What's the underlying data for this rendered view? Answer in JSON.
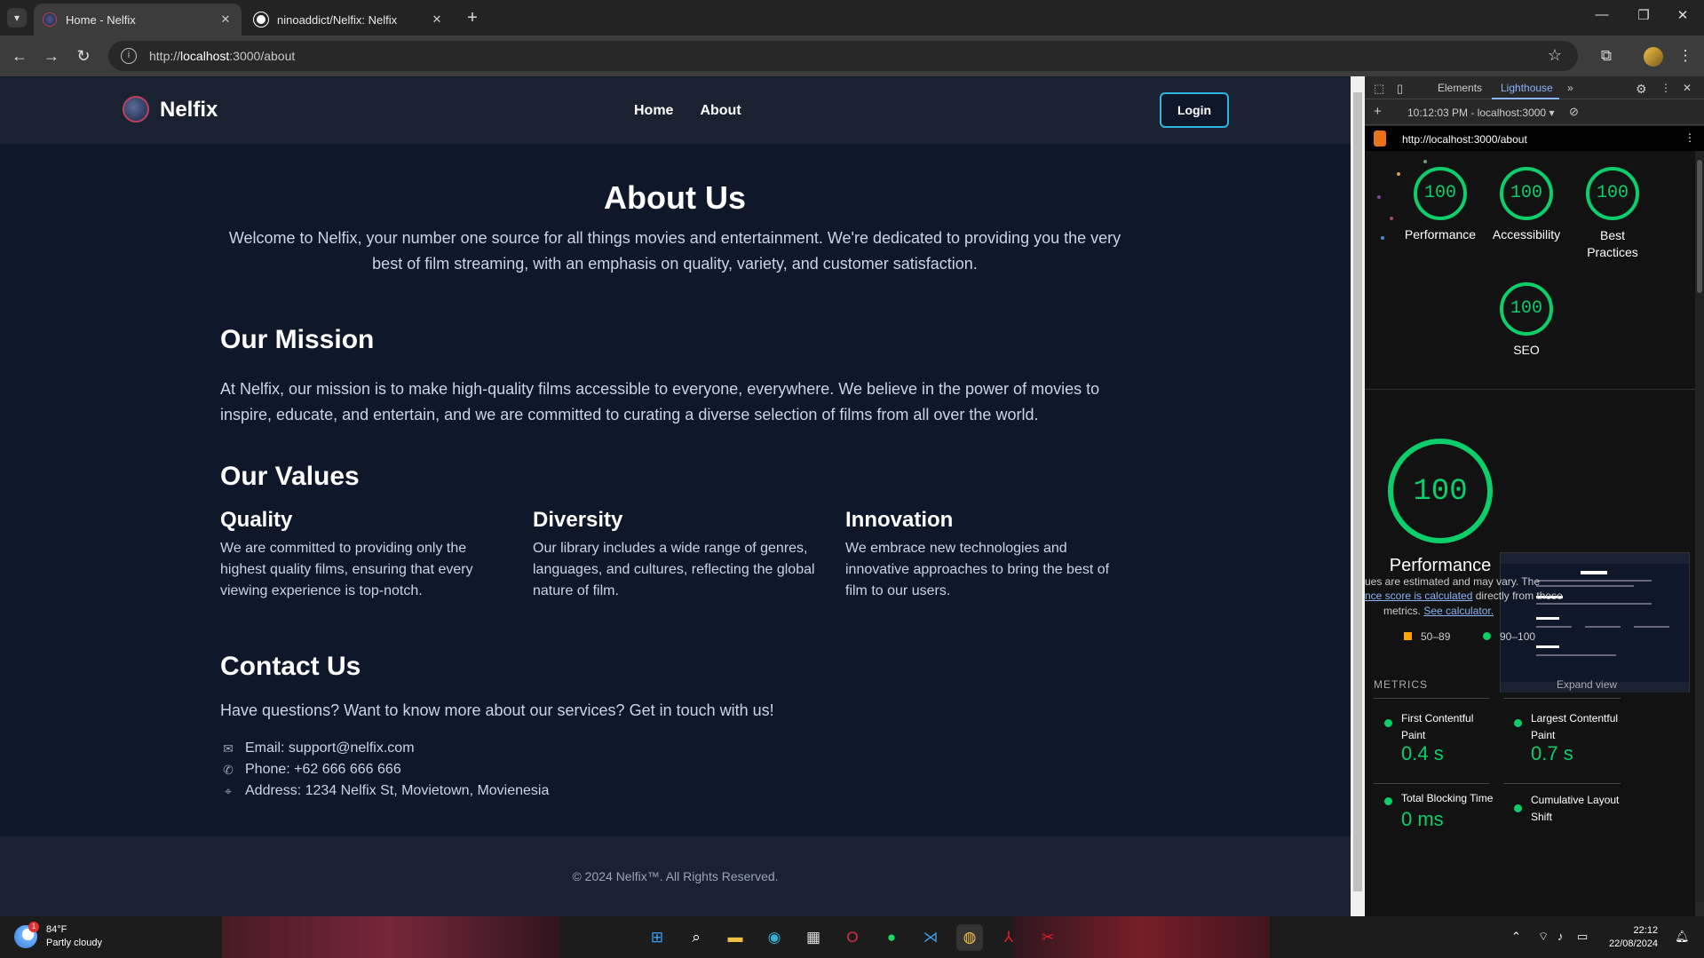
{
  "browser": {
    "tabs": [
      {
        "title": "Home - Nelfix",
        "active": true
      },
      {
        "title": "ninoaddict/Nelfix: Nelfix",
        "active": false
      }
    ],
    "url_prefix": "http://",
    "url_host": "localhost",
    "url_rest": ":3000/about"
  },
  "site": {
    "brand": "Nelfix",
    "nav": {
      "home": "Home",
      "about": "About"
    },
    "login": "Login",
    "about_title": "About Us",
    "intro": "Welcome to Nelfix, your number one source for all things movies and entertainment. We're dedicated to providing you the very best of film streaming, with an emphasis on quality, variety, and customer satisfaction.",
    "mission_title": "Our Mission",
    "mission_text": "At Nelfix, our mission is to make high-quality films accessible to everyone, everywhere. We believe in the power of movies to inspire, educate, and entertain, and we are committed to curating a diverse selection of films from all over the world.",
    "values_title": "Our Values",
    "values": [
      {
        "title": "Quality",
        "text": "We are committed to providing only the highest quality films, ensuring that every viewing experience is top-notch."
      },
      {
        "title": "Diversity",
        "text": "Our library includes a wide range of genres, languages, and cultures, reflecting the global nature of film."
      },
      {
        "title": "Innovation",
        "text": "We embrace new technologies and innovative approaches to bring the best of film to our users."
      }
    ],
    "contact_title": "Contact Us",
    "contact_intro": "Have questions? Want to know more about our services? Get in touch with us!",
    "contact": {
      "email": "Email: support@nelfix.com",
      "phone": "Phone: +62 666 666 666",
      "address": "Address: 1234 Nelfix St, Movietown, Movienesia"
    },
    "footer": "© 2024 Nelfix™. All Rights Reserved."
  },
  "devtools": {
    "tabs": [
      "Elements",
      "Lighthouse"
    ],
    "active_tab": "Lighthouse",
    "report_select": "10:12:03 PM - localhost:3000",
    "report_url": "http://localhost:3000/about",
    "scores": [
      {
        "label": "Performance",
        "value": "100"
      },
      {
        "label": "Accessibility",
        "value": "100"
      },
      {
        "label": "Best Practices",
        "value": "100"
      },
      {
        "label": "SEO",
        "value": "100"
      }
    ],
    "big_score": "100",
    "big_label": "Performance",
    "note_part1": "ues are estimated and may vary. The",
    "note_link1": "nce score is calculated",
    "note_part2": " directly from these",
    "note_part3": "metrics. ",
    "note_link2": "See calculator.",
    "legend_mid": "50–89",
    "legend_high": "90–100",
    "metrics_title": "METRICS",
    "expand_view": "Expand view",
    "metrics": [
      {
        "name": "First Contentful Paint",
        "value": "0.4 s"
      },
      {
        "name": "Largest Contentful Paint",
        "value": "0.7 s"
      },
      {
        "name": "Total Blocking Time",
        "value": "0 ms"
      },
      {
        "name": "Cumulative Layout Shift",
        "value": ""
      }
    ],
    "accent_green": "#0cce6b",
    "accent_orange": "#ffa400"
  },
  "taskbar": {
    "weather_temp": "84°F",
    "weather_desc": "Partly cloudy",
    "weather_badge": "1",
    "time": "22:12",
    "date": "22/08/2024"
  }
}
